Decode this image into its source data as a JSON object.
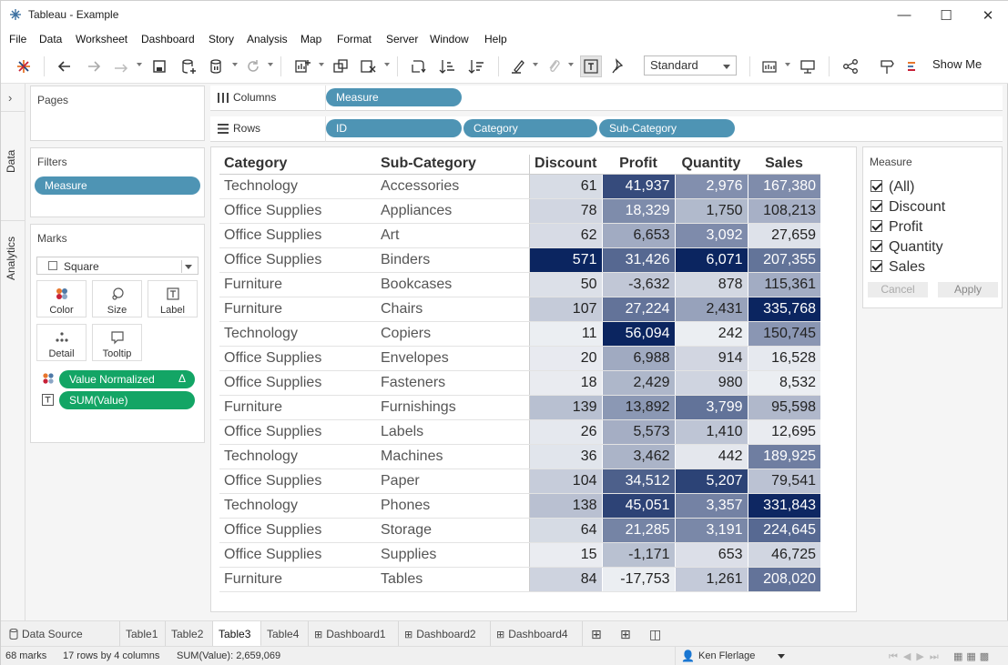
{
  "window": {
    "title": "Tableau - Example"
  },
  "menu": [
    "File",
    "Data",
    "Worksheet",
    "Dashboard",
    "Story",
    "Analysis",
    "Map",
    "Format",
    "Server",
    "Window",
    "Help"
  ],
  "toolbar": {
    "fit": "Standard",
    "show_me": "Show Me"
  },
  "side_tabs": {
    "data": "Data",
    "analytics": "Analytics"
  },
  "pages": {
    "title": "Pages"
  },
  "filters": {
    "title": "Filters",
    "pill": "Measure"
  },
  "marks": {
    "title": "Marks",
    "type": "Square",
    "buttons": {
      "color": "Color",
      "size": "Size",
      "label": "Label",
      "detail": "Detail",
      "tooltip": "Tooltip"
    },
    "pills": {
      "color_field": "Value Normalized",
      "color_field_flag": "Δ",
      "label_field": "SUM(Value)"
    }
  },
  "shelves": {
    "columns_label": "Columns",
    "rows_label": "Rows",
    "columns": [
      "Measure"
    ],
    "rows": [
      "ID",
      "Category",
      "Sub-Category"
    ]
  },
  "table": {
    "headers": [
      "Category",
      "Sub-Category",
      "Discount",
      "Profit",
      "Quantity",
      "Sales"
    ],
    "rows": [
      {
        "category": "Technology",
        "sub": "Accessories",
        "discount": "61",
        "profit": "41,937",
        "quantity": "2,976",
        "sales": "167,380"
      },
      {
        "category": "Office Supplies",
        "sub": "Appliances",
        "discount": "78",
        "profit": "18,329",
        "quantity": "1,750",
        "sales": "108,213"
      },
      {
        "category": "Office Supplies",
        "sub": "Art",
        "discount": "62",
        "profit": "6,653",
        "quantity": "3,092",
        "sales": "27,659"
      },
      {
        "category": "Office Supplies",
        "sub": "Binders",
        "discount": "571",
        "profit": "31,426",
        "quantity": "6,071",
        "sales": "207,355"
      },
      {
        "category": "Furniture",
        "sub": "Bookcases",
        "discount": "50",
        "profit": "-3,632",
        "quantity": "878",
        "sales": "115,361"
      },
      {
        "category": "Furniture",
        "sub": "Chairs",
        "discount": "107",
        "profit": "27,224",
        "quantity": "2,431",
        "sales": "335,768"
      },
      {
        "category": "Technology",
        "sub": "Copiers",
        "discount": "11",
        "profit": "56,094",
        "quantity": "242",
        "sales": "150,745"
      },
      {
        "category": "Office Supplies",
        "sub": "Envelopes",
        "discount": "20",
        "profit": "6,988",
        "quantity": "914",
        "sales": "16,528"
      },
      {
        "category": "Office Supplies",
        "sub": "Fasteners",
        "discount": "18",
        "profit": "2,429",
        "quantity": "980",
        "sales": "8,532"
      },
      {
        "category": "Furniture",
        "sub": "Furnishings",
        "discount": "139",
        "profit": "13,892",
        "quantity": "3,799",
        "sales": "95,598"
      },
      {
        "category": "Office Supplies",
        "sub": "Labels",
        "discount": "26",
        "profit": "5,573",
        "quantity": "1,410",
        "sales": "12,695"
      },
      {
        "category": "Technology",
        "sub": "Machines",
        "discount": "36",
        "profit": "3,462",
        "quantity": "442",
        "sales": "189,925"
      },
      {
        "category": "Office Supplies",
        "sub": "Paper",
        "discount": "104",
        "profit": "34,512",
        "quantity": "5,207",
        "sales": "79,541"
      },
      {
        "category": "Technology",
        "sub": "Phones",
        "discount": "138",
        "profit": "45,051",
        "quantity": "3,357",
        "sales": "331,843"
      },
      {
        "category": "Office Supplies",
        "sub": "Storage",
        "discount": "64",
        "profit": "21,285",
        "quantity": "3,191",
        "sales": "224,645"
      },
      {
        "category": "Office Supplies",
        "sub": "Supplies",
        "discount": "15",
        "profit": "-1,171",
        "quantity": "653",
        "sales": "46,725"
      },
      {
        "category": "Furniture",
        "sub": "Tables",
        "discount": "84",
        "profit": "-17,753",
        "quantity": "1,261",
        "sales": "208,020"
      }
    ],
    "color_low": "#ffffff",
    "color_high": "#0b2560"
  },
  "legend": {
    "title": "Measure",
    "items": [
      "(All)",
      "Discount",
      "Profit",
      "Quantity",
      "Sales"
    ],
    "cancel": "Cancel",
    "apply": "Apply"
  },
  "sheet_tabs": [
    "Data Source",
    "Table1",
    "Table2",
    "Table3",
    "Table4",
    "Dashboard1",
    "Dashboard2",
    "Dashboard4"
  ],
  "active_tab": "Table3",
  "status": {
    "marks": "68 marks",
    "dims": "17 rows by 4 columns",
    "sum": "SUM(Value): 2,659,069",
    "user": "Ken Flerlage"
  }
}
